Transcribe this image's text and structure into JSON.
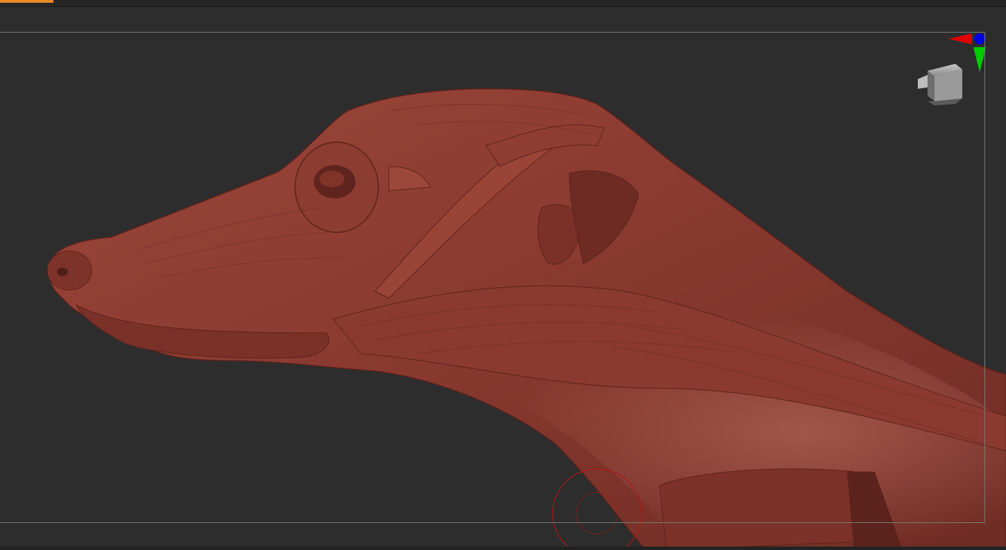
{
  "app": {
    "accent_color": "#e8892a",
    "background_color": "#2d2d2d"
  },
  "viewport": {
    "model": "sculpted-muscle-head-and-neck",
    "model_color": "#8a3a30",
    "gizmo": {
      "x_axis_color": "#e00000",
      "y_axis_color": "#00cc00",
      "z_axis_color": "#0000e0",
      "navigation_cube_color": "#9a9a9a"
    },
    "brush_cursor_color": "#b01818"
  }
}
